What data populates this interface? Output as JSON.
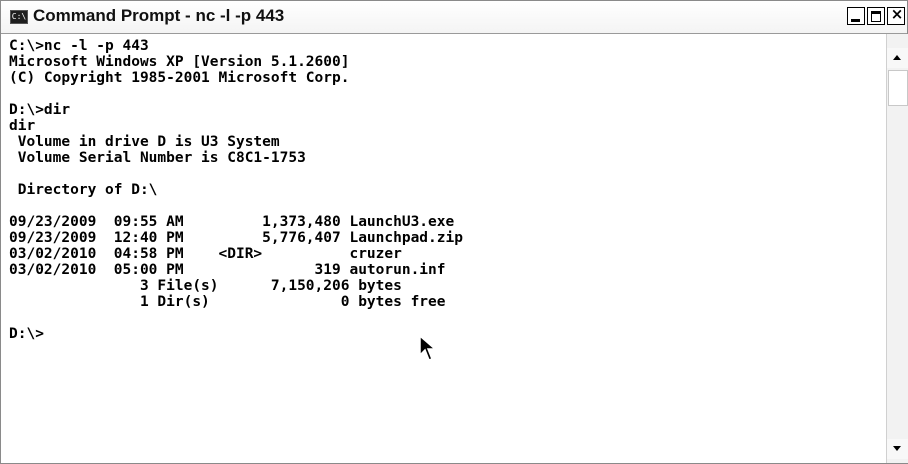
{
  "window": {
    "icon_text": "C:\\",
    "title": "Command Prompt - nc -l -p 443",
    "min_label": "",
    "max_label": "",
    "close_label": "×"
  },
  "console": {
    "lines": [
      "C:\\>nc -l -p 443",
      "Microsoft Windows XP [Version 5.1.2600]",
      "(C) Copyright 1985-2001 Microsoft Corp.",
      "",
      "D:\\>dir",
      "dir",
      " Volume in drive D is U3 System",
      " Volume Serial Number is C8C1-1753",
      "",
      " Directory of D:\\",
      "",
      "09/23/2009  09:55 AM         1,373,480 LaunchU3.exe",
      "09/23/2009  12:40 PM         5,776,407 Launchpad.zip",
      "03/02/2010  04:58 PM    <DIR>          cruzer",
      "03/02/2010  05:00 PM               319 autorun.inf",
      "               3 File(s)      7,150,206 bytes",
      "               1 Dir(s)               0 bytes free",
      "",
      "D:\\>"
    ]
  },
  "colors": {
    "console_background": "#ffffff",
    "console_text": "#000000",
    "titlebar_background": "#f4f4f4"
  },
  "icons": {
    "app": "console-icon",
    "cursor": "mouse-pointer-icon"
  }
}
